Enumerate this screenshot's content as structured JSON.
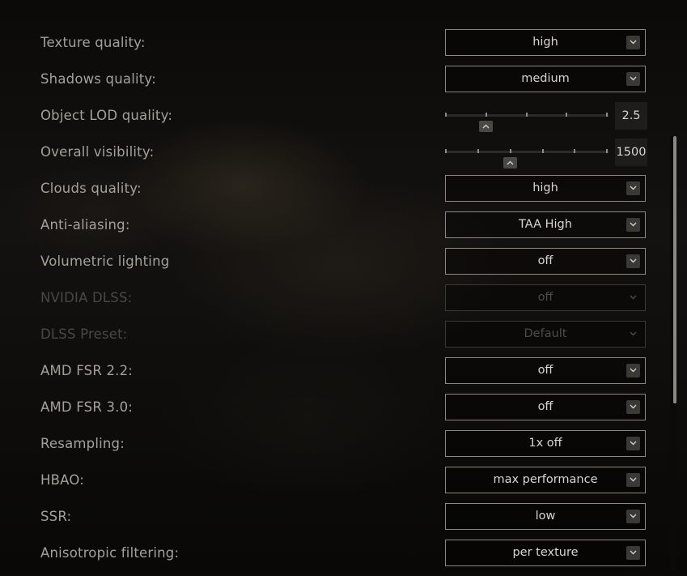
{
  "settings": {
    "texture_quality": {
      "label": "Texture quality:",
      "value": "high"
    },
    "shadows_quality": {
      "label": "Shadows quality:",
      "value": "medium"
    },
    "object_lod": {
      "label": "Object LOD quality:",
      "value": "2.5",
      "fraction": 0.2
    },
    "overall_visibility": {
      "label": "Overall visibility:",
      "value": "1500",
      "fraction": 0.4
    },
    "clouds_quality": {
      "label": "Clouds quality:",
      "value": "high"
    },
    "anti_aliasing": {
      "label": "Anti-aliasing:",
      "value": "TAA High"
    },
    "volumetric_lighting": {
      "label": "Volumetric lighting",
      "value": "off"
    },
    "nvidia_dlss": {
      "label": "NVIDIA DLSS:",
      "value": "off"
    },
    "dlss_preset": {
      "label": "DLSS Preset:",
      "value": "Default"
    },
    "amd_fsr_22": {
      "label": "AMD FSR 2.2:",
      "value": "off"
    },
    "amd_fsr_30": {
      "label": "AMD FSR 3.0:",
      "value": "off"
    },
    "resampling": {
      "label": "Resampling:",
      "value": "1x off"
    },
    "hbao": {
      "label": "HBAO:",
      "value": "max performance"
    },
    "ssr": {
      "label": "SSR:",
      "value": "low"
    },
    "anisotropic": {
      "label": "Anisotropic filtering:",
      "value": "per texture"
    }
  },
  "icons": {
    "dropdown": "chevron-down-icon",
    "slider_knob": "chevron-up-icon"
  },
  "colors": {
    "label": "#a3a19a",
    "label_disabled": "#4a4844",
    "value": "#d8d6cf",
    "border": "#8a8880"
  }
}
